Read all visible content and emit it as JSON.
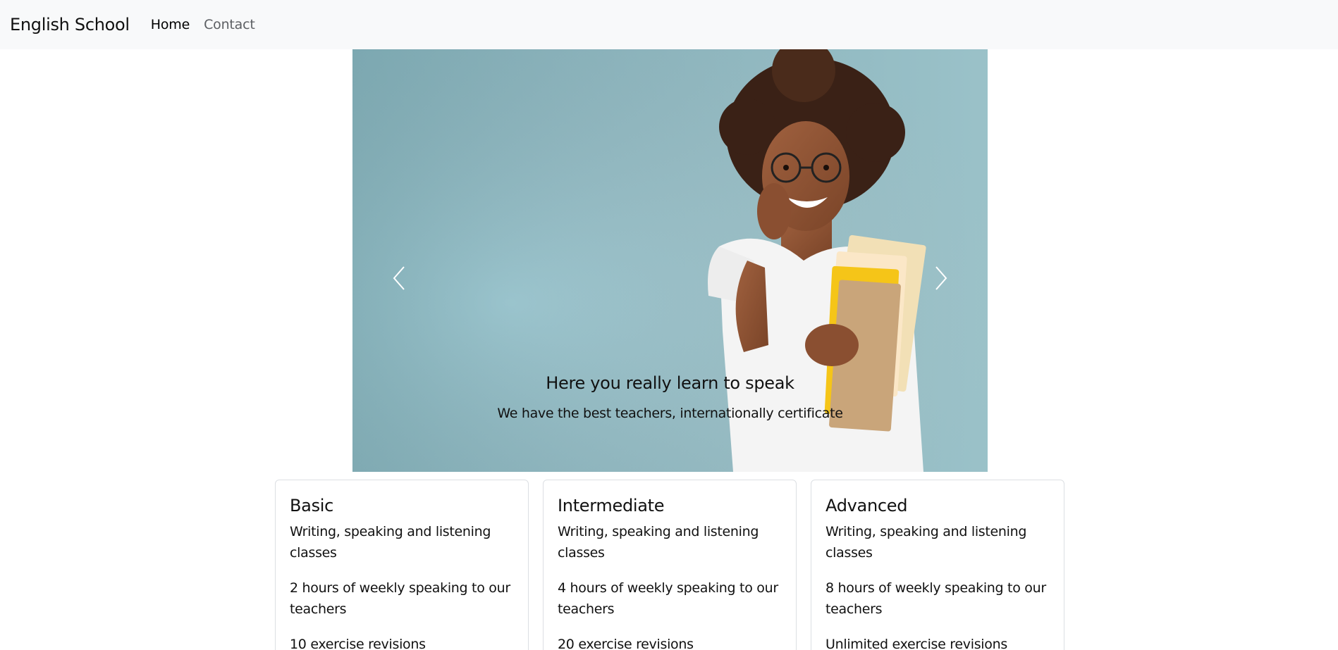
{
  "navbar": {
    "brand": "English School",
    "links": [
      {
        "label": "Home",
        "active": true
      },
      {
        "label": "Contact",
        "active": false
      }
    ]
  },
  "carousel": {
    "slide_image": "student-holding-notebooks-photo",
    "caption_title": "Here you really learn to speak",
    "caption_text": "We have the best teachers, internationally certificate",
    "prev_icon": "chevron-left-icon",
    "next_icon": "chevron-right-icon"
  },
  "plans": [
    {
      "title": "Basic",
      "features": [
        "Writing, speaking and listening classes",
        "2 hours of weekly speaking to our teachers",
        "10 exercise revisions"
      ]
    },
    {
      "title": "Intermediate",
      "features": [
        "Writing, speaking and listening classes",
        "4 hours of weekly speaking to our teachers",
        "20 exercise revisions"
      ]
    },
    {
      "title": "Advanced",
      "features": [
        "Writing, speaking and listening classes",
        "8 hours of weekly speaking to our teachers",
        "Unlimited exercise revisions"
      ]
    }
  ]
}
